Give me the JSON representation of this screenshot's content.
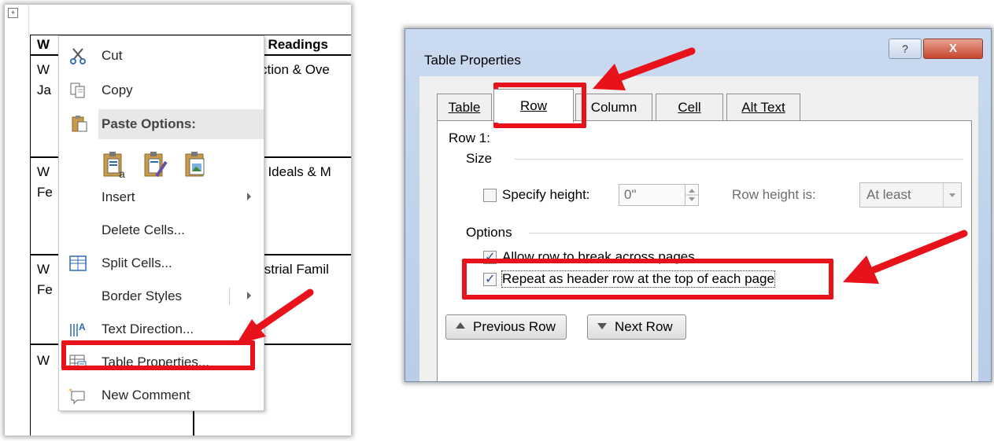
{
  "document": {
    "header_left_partial": "W",
    "header_right_partial": "/ Readings",
    "rows": [
      {
        "left_line1": "W",
        "left_line2": "Ja",
        "right": "ction & Ove"
      },
      {
        "left_line1": "W",
        "left_line2": "Fe",
        "right": ", Ideals & M"
      },
      {
        "left_line1": "W",
        "left_line2": "Fe",
        "right": "ıstrial Famil"
      },
      {
        "left_line1": "W",
        "left_line2": "",
        "right": ""
      }
    ]
  },
  "context_menu": {
    "cut": "Cut",
    "copy": "Copy",
    "paste_options": "Paste Options:",
    "insert": "Insert",
    "delete_cells": "Delete Cells...",
    "split_cells": "Split Cells...",
    "border_styles": "Border Styles",
    "text_direction": "Text Direction...",
    "table_properties": "Table Properties...",
    "new_comment": "New Comment"
  },
  "dialog": {
    "title": "Table Properties",
    "help_label": "?",
    "close_label": "X",
    "tabs": [
      "Table",
      "Row",
      "Column",
      "Cell",
      "Alt Text"
    ],
    "active_tab": "Row",
    "row_heading": "Row 1:",
    "size_heading": "Size",
    "specify_height_label": "Specify height:",
    "height_value": "0\"",
    "row_height_is_label": "Row height is:",
    "row_height_option": "At least",
    "options_heading": "Options",
    "allow_break_label": "Allow row to break across pages",
    "allow_break_checked": true,
    "repeat_header_label": "Repeat as header row at the top of each page",
    "repeat_header_checked": true,
    "specify_height_checked": false,
    "previous_row_label": "Previous Row",
    "next_row_label": "Next Row"
  },
  "colors": {
    "highlight": "#e8121b",
    "dialog_title_bar": "#c9daf0",
    "close_button": "#c8452e"
  }
}
